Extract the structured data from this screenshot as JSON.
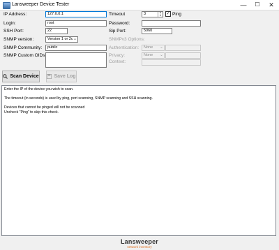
{
  "window": {
    "title": "Lansweeper Device Tester",
    "controls": {
      "minimize": "—",
      "maximize": "☐",
      "close": "✕"
    }
  },
  "form": {
    "ip_label": "IP Address:",
    "ip_value": "127.0.0.1",
    "login_label": "Login:",
    "login_value": "root",
    "ssh_port_label": "SSH Port:",
    "ssh_port_value": "22",
    "snmp_version_label": "SNMP version:",
    "snmp_version_value": "Version 1 or 2c",
    "snmp_community_label": "SNMP Community:",
    "snmp_community_value": "public",
    "snmp_oids_label": "SNMP Custom OIDs:",
    "timeout_label": "Timeout",
    "timeout_value": "3",
    "ping_label": "Ping",
    "ping_checked": true,
    "password_label": "Password:",
    "password_value": "",
    "sip_port_label": "Sip Port:",
    "sip_port_value": "5060",
    "snmpv3_title": "SNMPv3 Options:",
    "auth_label": "Authentication:",
    "auth_value": "None",
    "privacy_label": "Privacy:",
    "context_label": "Context:",
    "privacy_value": "None"
  },
  "buttons": {
    "scan": "Scan Device",
    "save": "Save Log"
  },
  "output_lines": [
    "Enter the IP of the device you wish to scan.",
    "",
    "The timeout (in seconds) is used by ping, port scanning, SNMP scanning and SSH scanning.",
    "",
    "Devices that cannot be pinged will not be scanned",
    "Uncheck \"Ping\" to skip this check."
  ],
  "footer": {
    "brand": "Lansweeper",
    "tagline": "network inventory"
  },
  "colors": {
    "accent": "#0078d7",
    "logo_orange": "#e07020"
  }
}
